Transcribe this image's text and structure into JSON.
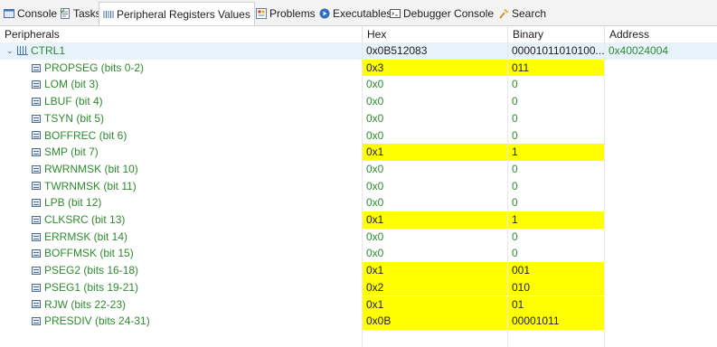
{
  "tabs": [
    {
      "label": "Console",
      "icon": "console-icon"
    },
    {
      "label": "Tasks",
      "icon": "tasks-icon"
    },
    {
      "label": "Peripheral Registers Values",
      "icon": "registers-icon",
      "close": "✕",
      "active": true
    },
    {
      "label": "Problems",
      "icon": "problems-icon"
    },
    {
      "label": "Executables",
      "icon": "executables-icon"
    },
    {
      "label": "Debugger Console",
      "icon": "debugger-console-icon"
    },
    {
      "label": "Search",
      "icon": "search-icon"
    }
  ],
  "columns": {
    "peripherals": "Peripherals",
    "hex": "Hex",
    "binary": "Binary",
    "address": "Address"
  },
  "register": {
    "name": "CTRL1",
    "hex": "0x0B512083",
    "binary": "00001011010100...",
    "address": "0x40024004",
    "expander": "⌄"
  },
  "fields": [
    {
      "name": "PROPSEG (bits 0-2)",
      "hex": "0x3",
      "binary": "011",
      "highlight": true
    },
    {
      "name": "LOM (bit 3)",
      "hex": "0x0",
      "binary": "0",
      "highlight": false
    },
    {
      "name": "LBUF (bit 4)",
      "hex": "0x0",
      "binary": "0",
      "highlight": false
    },
    {
      "name": "TSYN (bit 5)",
      "hex": "0x0",
      "binary": "0",
      "highlight": false
    },
    {
      "name": "BOFFREC (bit 6)",
      "hex": "0x0",
      "binary": "0",
      "highlight": false
    },
    {
      "name": "SMP (bit 7)",
      "hex": "0x1",
      "binary": "1",
      "highlight": true
    },
    {
      "name": "RWRNMSK (bit 10)",
      "hex": "0x0",
      "binary": "0",
      "highlight": false
    },
    {
      "name": "TWRNMSK (bit 11)",
      "hex": "0x0",
      "binary": "0",
      "highlight": false
    },
    {
      "name": "LPB (bit 12)",
      "hex": "0x0",
      "binary": "0",
      "highlight": false
    },
    {
      "name": "CLKSRC (bit 13)",
      "hex": "0x1",
      "binary": "1",
      "highlight": true
    },
    {
      "name": "ERRMSK (bit 14)",
      "hex": "0x0",
      "binary": "0",
      "highlight": false
    },
    {
      "name": "BOFFMSK (bit 15)",
      "hex": "0x0",
      "binary": "0",
      "highlight": false
    },
    {
      "name": "PSEG2 (bits 16-18)",
      "hex": "0x1",
      "binary": "001",
      "highlight": true
    },
    {
      "name": "PSEG1 (bits 19-21)",
      "hex": "0x2",
      "binary": "010",
      "highlight": true
    },
    {
      "name": "RJW (bits 22-23)",
      "hex": "0x1",
      "binary": "01",
      "highlight": true
    },
    {
      "name": "PRESDIV (bits 24-31)",
      "hex": "0x0B",
      "binary": "00001011",
      "highlight": true
    }
  ],
  "colors": {
    "highlight": "#ffff00",
    "value_green": "#2e8b2e",
    "selected_row": "#e8f2fb"
  }
}
